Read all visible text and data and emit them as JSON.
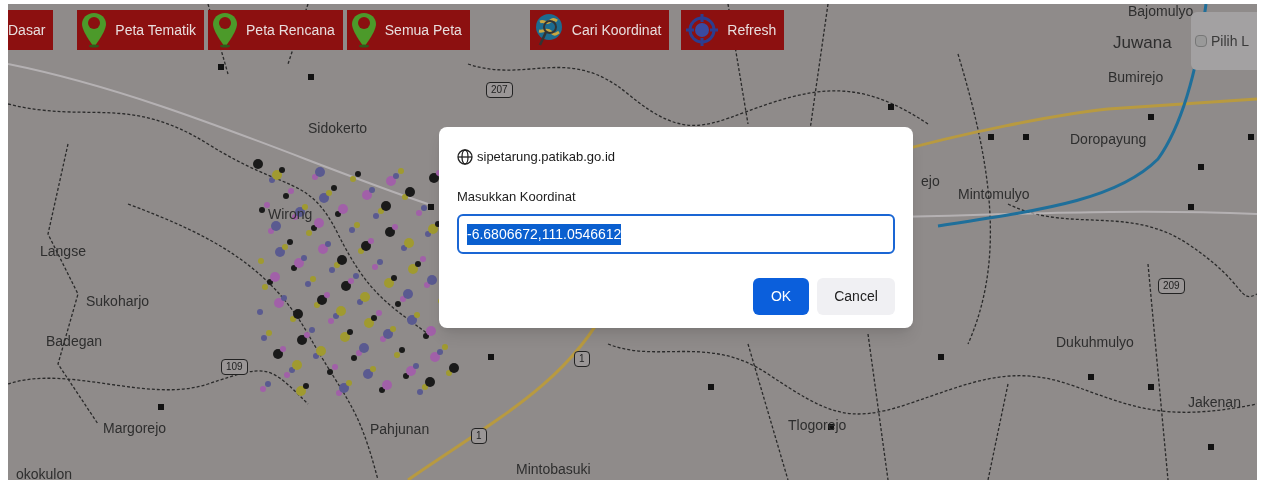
{
  "toolbar": [
    {
      "label": "Dasar",
      "kind": "plain"
    },
    {
      "label": "Peta Tematik",
      "kind": "pin"
    },
    {
      "label": "Peta Rencana",
      "kind": "pin"
    },
    {
      "label": "Semua Peta",
      "kind": "pin"
    },
    {
      "label": "Cari Koordinat",
      "kind": "globe"
    },
    {
      "label": "Refresh",
      "kind": "target"
    }
  ],
  "layer_panel": {
    "label": "Pilih L"
  },
  "map": {
    "places": [
      "Bajomulyo",
      "Juwana",
      "Bumirejo",
      "Doropayung",
      "Mintomulyo",
      "ejo",
      "Sidokerto",
      "Wirong",
      "Langse",
      "Sukoharjo",
      "Badegan",
      "Margorejo",
      "Pahjunan",
      "okokulon",
      "Mintobasuki",
      "Tlogorejo",
      "Dukuhmulyo",
      "Jakenan"
    ],
    "road_shields": [
      "207",
      "109",
      "1",
      "1",
      "209"
    ]
  },
  "dialog": {
    "origin": "sipetarung.patikab.go.id",
    "prompt": "Masukkan Koordinat",
    "value": "-6.6806672,111.0546612",
    "value_selected": true,
    "buttons": [
      {
        "label": "OK",
        "kind": "primary"
      },
      {
        "label": "Cancel",
        "kind": "secondary"
      }
    ]
  }
}
